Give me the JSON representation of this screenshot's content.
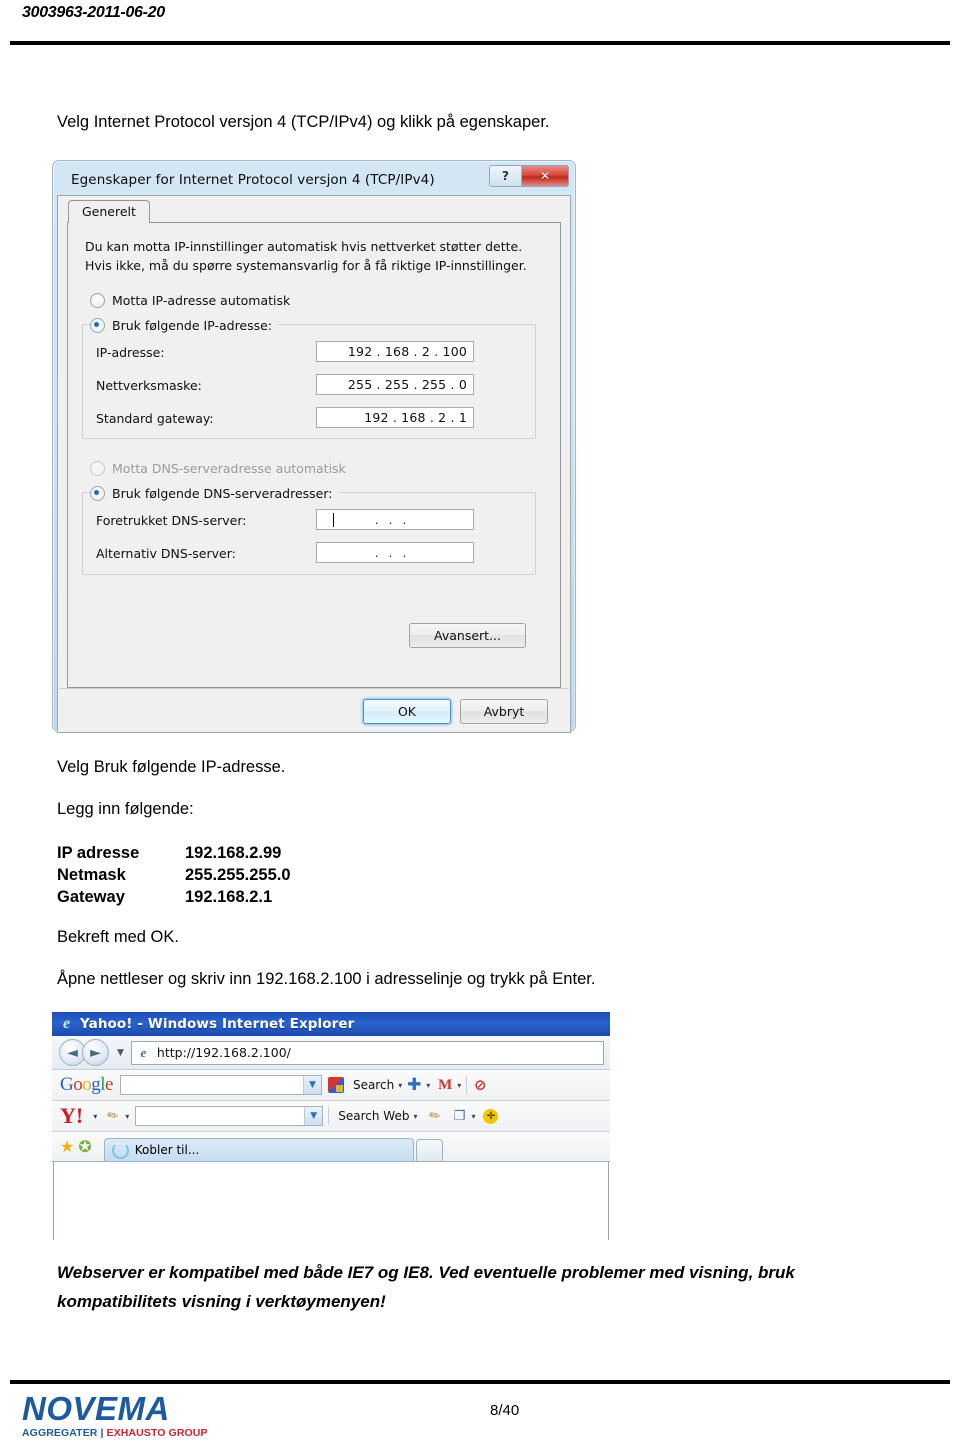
{
  "header": {
    "doc_id": "3003963-2011-06-20"
  },
  "instructions": {
    "heading": "Velg Internet Protocol versjon 4 (TCP/IPv4) og klikk på egenskaper.",
    "velg_bruk": "Velg Bruk følgende IP-adresse.",
    "legg_inn": "Legg inn følgende:",
    "bekreft": "Bekreft med OK.",
    "apne_nettleser": "Åpne nettleser og skriv inn 192.168.2.100 i adresselinje og trykk på Enter."
  },
  "ip_settings_list": [
    {
      "label": "IP adresse",
      "value": "192.168.2.99"
    },
    {
      "label": "Netmask",
      "value": "255.255.255.0"
    },
    {
      "label": "Gateway",
      "value": "192.168.2.1"
    }
  ],
  "closing_note": "Webserver er kompatibel med både IE7 og IE8. Ved eventuelle problemer med visning, bruk kompatibilitets visning i verktøymenyen!",
  "footer": {
    "logo_main": "NOVEMA",
    "logo_sub_left": "AGGREGATER",
    "logo_sub_divider": "|",
    "logo_sub_right": "EXHAUSTO GROUP",
    "page_number": "8/40",
    "logo_blue": "#1d5a9e",
    "logo_red": "#d3202a"
  },
  "dialog": {
    "title": "Egenskaper for Internet Protocol versjon 4 (TCP/IPv4)",
    "help_button": "?",
    "close_button": "✕",
    "tab": "Generelt",
    "hint_line1": "Du kan motta IP-innstillinger automatisk hvis nettverket støtter dette.",
    "hint_line2": "Hvis ikke, må du spørre systemansvarlig for å få riktige IP-innstillinger.",
    "radio_auto_ip": "Motta IP-adresse automatisk",
    "radio_manual_ip": "Bruk følgende IP-adresse:",
    "radio_auto_dns": "Motta DNS-serveradresse automatisk",
    "radio_manual_dns": "Bruk følgende DNS-serveradresser:",
    "fields": {
      "ip_label": "IP-adresse:",
      "ip_value": "192 . 168 .  2  . 100",
      "mask_label": "Nettverksmaske:",
      "mask_value": "255 . 255 . 255 .  0",
      "gateway_label": "Standard gateway:",
      "gateway_value": "192 . 168 .  2  .  1",
      "dns_pref_label": "Foretrukket DNS-server:",
      "dns_pref_value": ". . .",
      "dns_alt_label": "Alternativ DNS-server:",
      "dns_alt_value": ". . ."
    },
    "buttons": {
      "advanced": "Avansert...",
      "ok": "OK",
      "cancel": "Avbryt"
    }
  },
  "browser": {
    "window_title": "Yahoo! - Windows Internet Explorer",
    "ie_logo": "e",
    "back_arrow": "◄",
    "forward_arrow": "►",
    "nav_dropdown": "▼",
    "address_value": "http://192.168.2.100/",
    "google": {
      "g1": "G",
      "o1": "o",
      "o2": "o",
      "g2": "g",
      "l": "l",
      "e": "e"
    },
    "google_search_label": "Search",
    "yahoo_logo": "Y!",
    "yahoo_search_label": "Search Web",
    "tab_label": "Kobler til...",
    "dropdown_caret": "▼",
    "small_caret": "▾",
    "plus_icon": "✚",
    "gmail_icon": "M",
    "block_icon": "⊘",
    "pencil_icon": "✎",
    "window_icon": "❐",
    "target_icon": "✛",
    "star_gold": "★",
    "star_green": "✪"
  }
}
